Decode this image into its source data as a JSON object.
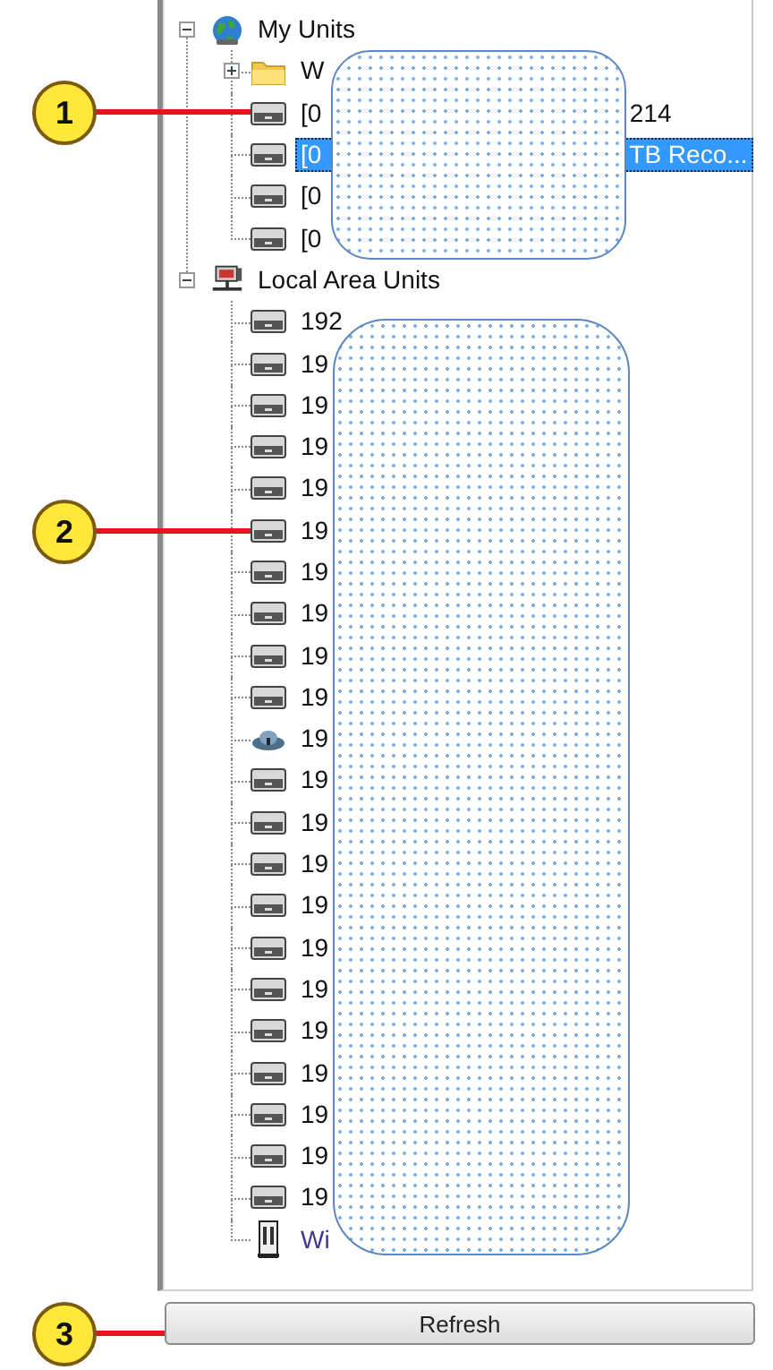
{
  "tree": [
    {
      "label": "My Units",
      "kind": "globe",
      "expanded": true,
      "selected": false,
      "children": [
        {
          "label": "W",
          "kind": "folder",
          "expanded": false,
          "selected": false
        },
        {
          "label": "[0",
          "label_end": "214",
          "kind": "device",
          "selected": false
        },
        {
          "label": "[0",
          "label_end": "TB Reco...",
          "kind": "device",
          "selected": true
        },
        {
          "label": "[0",
          "kind": "device",
          "selected": false
        },
        {
          "label": "[0",
          "kind": "device",
          "selected": false
        }
      ]
    },
    {
      "label": "Local Area Units",
      "kind": "network",
      "expanded": true,
      "selected": false,
      "children": [
        {
          "label": "192",
          "kind": "device",
          "selected": false
        },
        {
          "label": "19",
          "kind": "device",
          "selected": false
        },
        {
          "label": "19",
          "kind": "device",
          "selected": false
        },
        {
          "label": "19",
          "kind": "device",
          "selected": false
        },
        {
          "label": "19",
          "kind": "device",
          "selected": false
        },
        {
          "label": "19",
          "kind": "device",
          "selected": false
        },
        {
          "label": "19",
          "kind": "device",
          "selected": false
        },
        {
          "label": "19",
          "kind": "device",
          "selected": false
        },
        {
          "label": "19",
          "kind": "device",
          "selected": false
        },
        {
          "label": "19",
          "kind": "device",
          "selected": false
        },
        {
          "label": "19",
          "kind": "cloud",
          "selected": false
        },
        {
          "label": "19",
          "kind": "device",
          "selected": false
        },
        {
          "label": "19",
          "kind": "device",
          "selected": false
        },
        {
          "label": "19",
          "kind": "device",
          "selected": false
        },
        {
          "label": "19",
          "kind": "device",
          "selected": false
        },
        {
          "label": "19",
          "kind": "device",
          "selected": false
        },
        {
          "label": "19",
          "kind": "device",
          "selected": false
        },
        {
          "label": "19",
          "kind": "device",
          "selected": false
        },
        {
          "label": "19",
          "kind": "device",
          "selected": false
        },
        {
          "label": "19",
          "kind": "device",
          "selected": false
        },
        {
          "label": "19",
          "kind": "device",
          "selected": false
        },
        {
          "label": "19",
          "kind": "device",
          "selected": false
        },
        {
          "label": "Wi",
          "kind": "server",
          "selected": false
        }
      ]
    }
  ],
  "refresh_button": "Refresh",
  "callouts": [
    {
      "number": "1"
    },
    {
      "number": "2"
    },
    {
      "number": "3"
    }
  ]
}
